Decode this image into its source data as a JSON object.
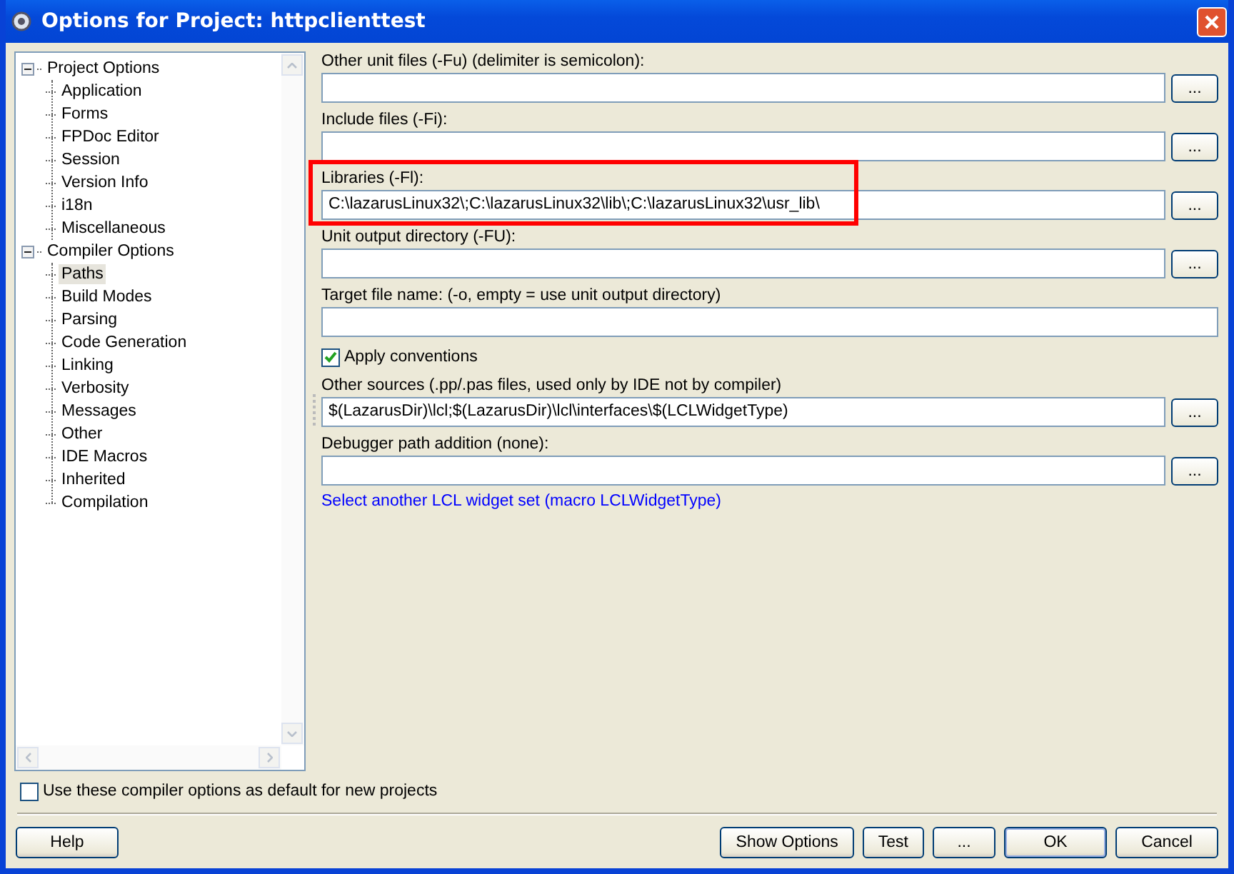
{
  "window": {
    "title": "Options for Project: httpclienttest"
  },
  "tree": [
    {
      "label": "Project Options",
      "expanded": true,
      "selected": false,
      "children": [
        {
          "label": "Application",
          "selected": false
        },
        {
          "label": "Forms",
          "selected": false
        },
        {
          "label": "FPDoc Editor",
          "selected": false
        },
        {
          "label": "Session",
          "selected": false
        },
        {
          "label": "Version Info",
          "selected": false
        },
        {
          "label": "i18n",
          "selected": false
        },
        {
          "label": "Miscellaneous",
          "selected": false
        }
      ]
    },
    {
      "label": "Compiler Options",
      "expanded": true,
      "selected": false,
      "children": [
        {
          "label": "Paths",
          "selected": true
        },
        {
          "label": "Build Modes",
          "selected": false
        },
        {
          "label": "Parsing",
          "selected": false
        },
        {
          "label": "Code Generation",
          "selected": false
        },
        {
          "label": "Linking",
          "selected": false
        },
        {
          "label": "Verbosity",
          "selected": false
        },
        {
          "label": "Messages",
          "selected": false
        },
        {
          "label": "Other",
          "selected": false
        },
        {
          "label": "IDE Macros",
          "selected": false
        },
        {
          "label": "Inherited",
          "selected": false
        },
        {
          "label": "Compilation",
          "selected": false
        }
      ]
    }
  ],
  "fields": [
    {
      "kind": "browse",
      "label": "Other unit files (-Fu) (delimiter is semicolon):",
      "button": "...",
      "highlighted": false
    },
    {
      "kind": "browse",
      "label": "Include files (-Fi):",
      "button": "...",
      "highlighted": false
    },
    {
      "kind": "browse",
      "label": "Libraries (-Fl):",
      "value": "C:\\lazarusLinux32\\;C:\\lazarusLinux32\\lib\\;C:\\lazarusLinux32\\usr_lib\\",
      "button": "...",
      "highlighted": true
    },
    {
      "kind": "browse",
      "label": "Unit output directory (-FU):",
      "button": "...",
      "highlighted": false
    },
    {
      "kind": "plain",
      "label": "Target file name: (-o, empty = use unit output directory)",
      "highlighted": false
    },
    {
      "kind": "checkbox",
      "label": "Apply conventions",
      "checked": true
    },
    {
      "kind": "browse",
      "label": "Other sources (.pp/.pas files, used only by IDE not by compiler)",
      "value": "$(LazarusDir)\\lcl;$(LazarusDir)\\lcl\\interfaces\\$(LCLWidgetType)",
      "button": "...",
      "highlighted": false
    },
    {
      "kind": "browse",
      "label": "Debugger path addition (none):",
      "button": "...",
      "highlighted": false
    },
    {
      "kind": "link",
      "label": "Select another LCL widget set (macro LCLWidgetType)"
    }
  ],
  "default_option": {
    "label": "Use these compiler options as default for new projects",
    "checked": false
  },
  "buttons_left": [
    {
      "label": "Help",
      "default": false
    }
  ],
  "buttons_right": [
    {
      "label": "Show Options",
      "default": false
    },
    {
      "label": "Test",
      "default": false
    },
    {
      "label": "...",
      "default": false
    },
    {
      "label": "OK",
      "default": true
    },
    {
      "label": "Cancel",
      "default": false
    }
  ]
}
